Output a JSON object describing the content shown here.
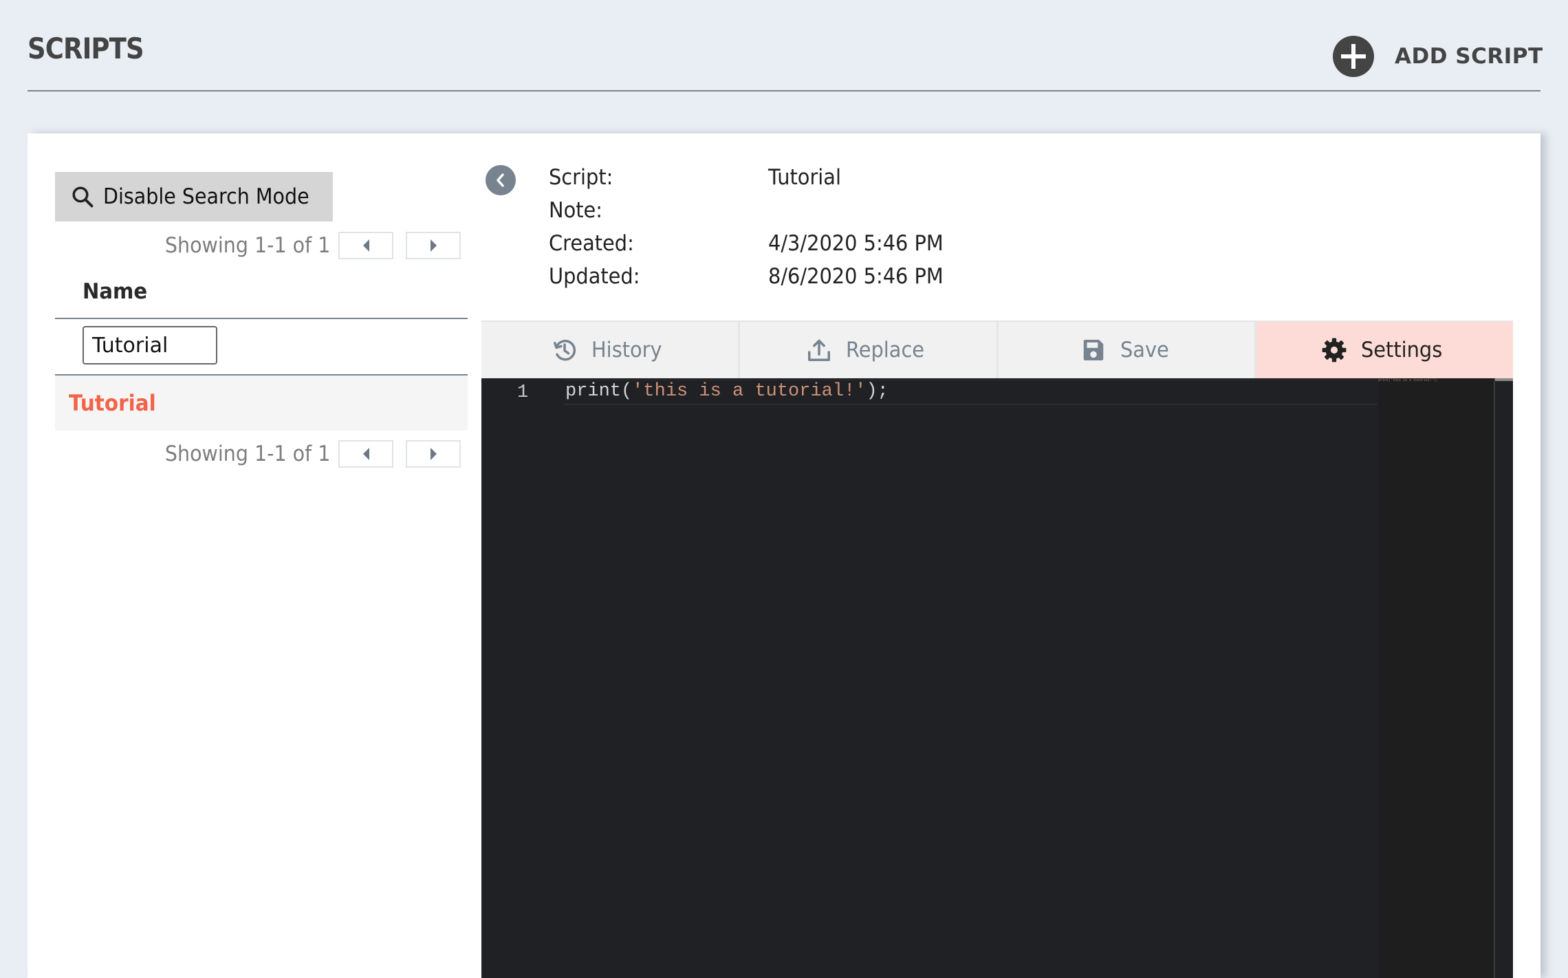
{
  "header": {
    "title": "SCRIPTS",
    "add_button_label": "ADD SCRIPT",
    "add_icon": "plus-circle-icon"
  },
  "sidebar": {
    "search_mode_button": {
      "label": "Disable Search Mode",
      "icon": "search-icon"
    },
    "pager_top": {
      "text": "Showing 1-1 of 1",
      "prev_icon": "caret-left-icon",
      "next_icon": "caret-right-icon"
    },
    "table": {
      "columns": [
        {
          "label": "Name"
        }
      ],
      "filter": {
        "name_value": "Tutorial",
        "name_placeholder": ""
      },
      "rows": [
        {
          "name": "Tutorial",
          "selected": true
        }
      ]
    },
    "pager_bottom": {
      "text": "Showing 1-1 of 1",
      "prev_icon": "caret-left-icon",
      "next_icon": "caret-right-icon"
    }
  },
  "detail": {
    "back_icon": "chevron-left-circle-icon",
    "fields": [
      {
        "label": "Script:",
        "value": "Tutorial"
      },
      {
        "label": "Note:",
        "value": ""
      },
      {
        "label": "Created:",
        "value": "4/3/2020 5:46 PM"
      },
      {
        "label": "Updated:",
        "value": "8/6/2020 5:46 PM"
      }
    ],
    "toolbar": [
      {
        "label": "History",
        "icon": "history-icon",
        "active": false
      },
      {
        "label": "Replace",
        "icon": "upload-icon",
        "active": false
      },
      {
        "label": "Save",
        "icon": "save-icon",
        "active": false
      },
      {
        "label": "Settings",
        "icon": "gear-icon",
        "active": true
      }
    ]
  },
  "editor": {
    "lines": [
      {
        "number": "1",
        "tokens": [
          {
            "text": "print(",
            "type": "plain"
          },
          {
            "text": "'this is a tutorial!'",
            "type": "string"
          },
          {
            "text": ");",
            "type": "plain"
          }
        ],
        "full_text": "print('this is a tutorial!');"
      }
    ]
  },
  "colors": {
    "accent": "#f26449",
    "background": "#e9eef4",
    "header_line": "#77838f",
    "editor_bg": "#202124",
    "string": "#ce9178",
    "active_tab": "#fddcd7"
  }
}
